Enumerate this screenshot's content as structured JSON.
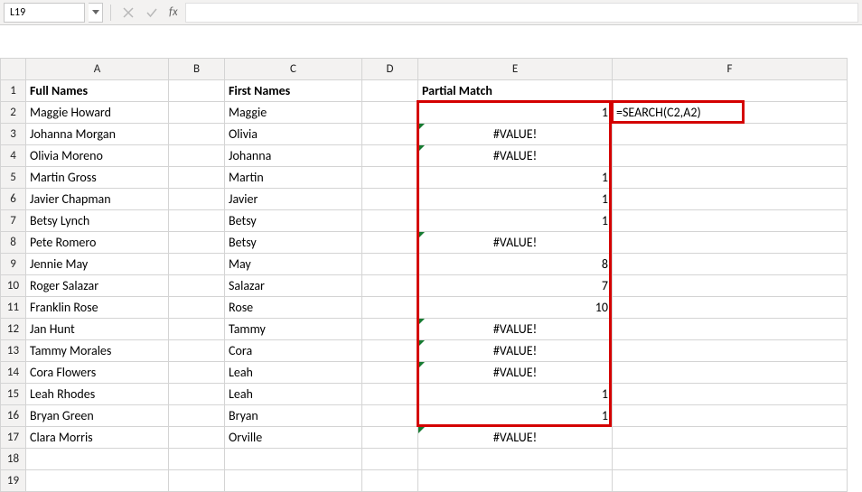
{
  "name_box": {
    "cell_ref": "L19"
  },
  "formula_bar": {
    "fx_label": "fx",
    "formula": ""
  },
  "col_headers": [
    "A",
    "B",
    "C",
    "D",
    "E",
    "F"
  ],
  "header_row": {
    "A": "Full Names",
    "C": "First Names",
    "E": "Partial Match"
  },
  "rows": [
    {
      "n": 1
    },
    {
      "n": 2,
      "A": "Maggie Howard",
      "C": "Maggie",
      "E": "1",
      "F": "=SEARCH(C2,A2)",
      "err": false
    },
    {
      "n": 3,
      "A": "Johanna Morgan",
      "C": "Olivia",
      "E": "#VALUE!",
      "err": true
    },
    {
      "n": 4,
      "A": "Olivia Moreno",
      "C": "Johanna",
      "E": "#VALUE!",
      "err": true
    },
    {
      "n": 5,
      "A": "Martin Gross",
      "C": "Martin",
      "E": "1",
      "err": false
    },
    {
      "n": 6,
      "A": "Javier Chapman",
      "C": "Javier",
      "E": "1",
      "err": false
    },
    {
      "n": 7,
      "A": "Betsy Lynch",
      "C": "Betsy",
      "E": "1",
      "err": false
    },
    {
      "n": 8,
      "A": "Pete Romero",
      "C": "Betsy",
      "E": "#VALUE!",
      "err": true
    },
    {
      "n": 9,
      "A": "Jennie May",
      "C": "May",
      "E": "8",
      "err": false
    },
    {
      "n": 10,
      "A": "Roger Salazar",
      "C": "Salazar",
      "E": "7",
      "err": false
    },
    {
      "n": 11,
      "A": "Franklin Rose",
      "C": "Rose",
      "E": "10",
      "err": false
    },
    {
      "n": 12,
      "A": "Jan Hunt",
      "C": "Tammy",
      "E": "#VALUE!",
      "err": true
    },
    {
      "n": 13,
      "A": "Tammy Morales",
      "C": "Cora",
      "E": "#VALUE!",
      "err": true
    },
    {
      "n": 14,
      "A": "Cora Flowers",
      "C": "Leah",
      "E": "#VALUE!",
      "err": true
    },
    {
      "n": 15,
      "A": "Leah Rhodes",
      "C": "Leah",
      "E": "1",
      "err": false
    },
    {
      "n": 16,
      "A": "Bryan Green",
      "C": "Bryan",
      "E": "1",
      "err": false
    },
    {
      "n": 17,
      "A": "Clara Morris",
      "C": "Orville",
      "E": "#VALUE!",
      "err": true
    },
    {
      "n": 18
    },
    {
      "n": 19
    }
  ],
  "annotations": {
    "red_box_col_E": {
      "top_row": 2,
      "bottom_row": 16
    },
    "red_box_F2": {
      "row": 2
    }
  }
}
